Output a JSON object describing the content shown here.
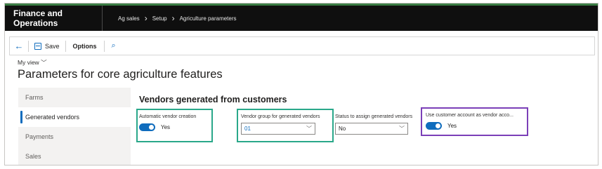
{
  "app_title": "Finance and Operations",
  "breadcrumb": [
    "Ag sales",
    "Setup",
    "Agriculture parameters"
  ],
  "toolbar": {
    "back_icon": "back-arrow-icon",
    "save_label": "Save",
    "options_label": "Options",
    "search_icon": "search-icon"
  },
  "view": {
    "label": "My view"
  },
  "page": {
    "title": "Parameters for core agriculture features"
  },
  "nav": {
    "items": [
      "Farms",
      "Generated vendors",
      "Payments",
      "Sales"
    ],
    "active_index": 1
  },
  "section": {
    "title": "Vendors generated from customers"
  },
  "fields": {
    "auto_vendor": {
      "label": "Automatic vendor creation",
      "value": "Yes",
      "on": true
    },
    "vendor_group": {
      "label": "Vendor group for generated vendors",
      "value": "01"
    },
    "status_assign": {
      "label": "Status to assign generated vendors",
      "value": "No"
    },
    "use_customer_account": {
      "label": "Use customer account as vendor acco...",
      "value": "Yes",
      "on": true
    }
  },
  "colors": {
    "accent": "#0f6cbd",
    "topbar": "#0f0f0f",
    "highlight_teal": "#2aa88a",
    "highlight_purple": "#7b3fb8"
  }
}
